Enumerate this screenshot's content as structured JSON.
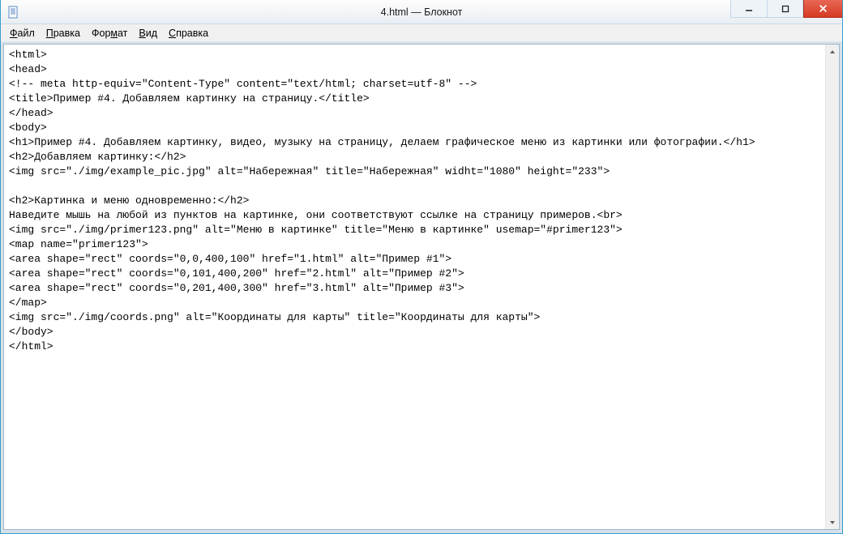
{
  "titlebar": {
    "title": "4.html — Блокнот"
  },
  "menu": {
    "file": {
      "u": "Ф",
      "rest": "айл"
    },
    "edit": {
      "u": "П",
      "rest": "равка"
    },
    "format": {
      "pre": "Фор",
      "u": "м",
      "rest": "ат"
    },
    "view": {
      "u": "В",
      "rest": "ид"
    },
    "help": {
      "u": "С",
      "rest": "правка"
    }
  },
  "content_lines": [
    "<html>",
    "<head>",
    "<!-- meta http-equiv=\"Content-Type\" content=\"text/html; charset=utf-8\" -->",
    "<title>Пример #4. Добавляем картинку на страницу.</title>",
    "</head>",
    "<body>",
    "<h1>Пример #4. Добавляем картинку, видео, музыку на страницу, делаем графическое меню из картинки или фотографии.</h1>",
    "<h2>Добавляем картинку:</h2>",
    "<img src=\"./img/example_pic.jpg\" alt=\"Набережная\" title=\"Набережная\" widht=\"1080\" height=\"233\">",
    "",
    "<h2>Картинка и меню одновременно:</h2>",
    "Наведите мышь на любой из пунктов на картинке, они соответствуют ссылке на страницу примеров.<br>",
    "<img src=\"./img/primer123.png\" alt=\"Меню в картинке\" title=\"Меню в картинке\" usemap=\"#primer123\">",
    "<map name=\"primer123\">",
    "<area shape=\"rect\" coords=\"0,0,400,100\" href=\"1.html\" alt=\"Пример #1\">",
    "<area shape=\"rect\" coords=\"0,101,400,200\" href=\"2.html\" alt=\"Пример #2\">",
    "<area shape=\"rect\" coords=\"0,201,400,300\" href=\"3.html\" alt=\"Пример #3\">",
    "</map>",
    "<img src=\"./img/coords.png\" alt=\"Координаты для карты\" title=\"Координаты для карты\">",
    "</body>",
    "</html>"
  ]
}
